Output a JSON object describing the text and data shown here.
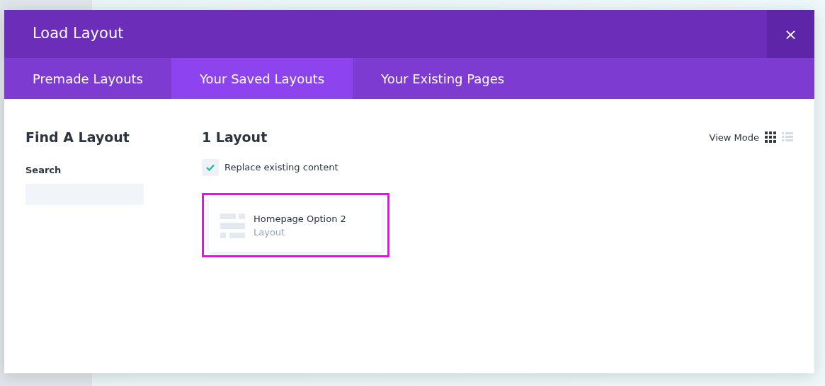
{
  "modal": {
    "title": "Load Layout",
    "close": "×"
  },
  "tabs": [
    {
      "label": "Premade Layouts",
      "selected": false
    },
    {
      "label": "Your Saved Layouts",
      "selected": true
    },
    {
      "label": "Your Existing Pages",
      "selected": false
    }
  ],
  "sidebar": {
    "heading": "Find A Layout",
    "search_label": "Search"
  },
  "main": {
    "count": "1 Layout",
    "view_mode_label": "View Mode",
    "view_modes": [
      {
        "kind": "grid",
        "selected": true
      },
      {
        "kind": "list",
        "selected": false
      }
    ],
    "replace_checkbox": {
      "label": "Replace existing content",
      "checked": true
    },
    "layouts": [
      {
        "name": "Homepage Option 2",
        "type": "Layout",
        "highlighted": true
      }
    ]
  }
}
